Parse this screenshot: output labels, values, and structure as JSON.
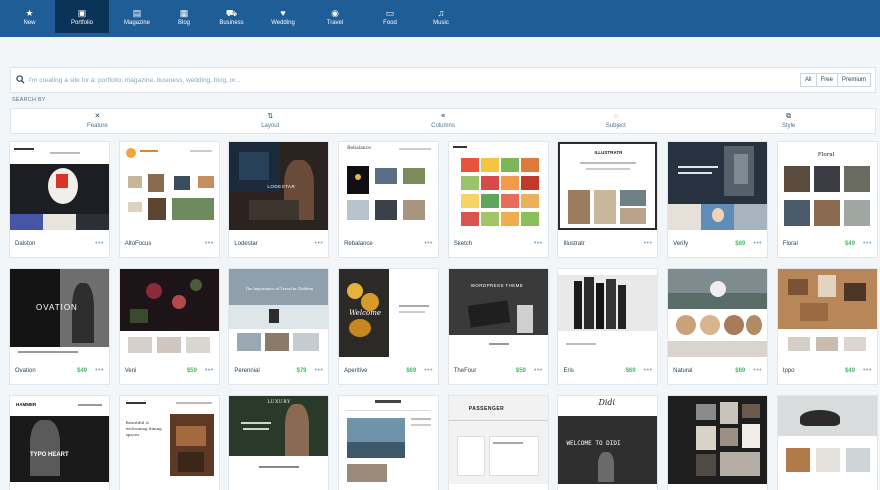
{
  "nav": {
    "items": [
      {
        "label": "New",
        "icon": "★"
      },
      {
        "label": "Portfolio",
        "icon": "▣"
      },
      {
        "label": "Magazine",
        "icon": "▤"
      },
      {
        "label": "Blog",
        "icon": "▦"
      },
      {
        "label": "Business",
        "icon": "⛟"
      },
      {
        "label": "Wedding",
        "icon": "♥"
      },
      {
        "label": "Travel",
        "icon": "◉"
      },
      {
        "label": "Food",
        "icon": "▭"
      },
      {
        "label": "Music",
        "icon": "♫"
      }
    ],
    "active": "Portfolio"
  },
  "search": {
    "placeholder": "I'm creating a site for a: portfolio, magazine, business, wedding, blog, or...",
    "icon": "search-icon",
    "filters": [
      "All",
      "Free",
      "Premium"
    ]
  },
  "search_by": "SEARCH BY",
  "facets": [
    {
      "label": "Feature",
      "icon": "✕"
    },
    {
      "label": "Layout",
      "icon": "⇅"
    },
    {
      "label": "Columns",
      "icon": "≡"
    },
    {
      "label": "Subject",
      "icon": "◌"
    },
    {
      "label": "Style",
      "icon": "⧉"
    }
  ],
  "themes": [
    {
      "name": "Dalston",
      "price": ""
    },
    {
      "name": "AltoFocus",
      "price": ""
    },
    {
      "name": "Lodestar",
      "price": ""
    },
    {
      "name": "Rebalance",
      "price": ""
    },
    {
      "name": "Sketch",
      "price": ""
    },
    {
      "name": "Illustratr",
      "price": ""
    },
    {
      "name": "Verify",
      "price": "$69"
    },
    {
      "name": "Floral",
      "price": "$49"
    },
    {
      "name": "Ovation",
      "price": "$49"
    },
    {
      "name": "Veni",
      "price": "$59"
    },
    {
      "name": "Perennial",
      "price": "$79"
    },
    {
      "name": "Aperitive",
      "price": "$69"
    },
    {
      "name": "TheFour",
      "price": "$59"
    },
    {
      "name": "Eris",
      "price": "$69"
    },
    {
      "name": "Natural",
      "price": "$69"
    },
    {
      "name": "Ippo",
      "price": "$49"
    },
    {
      "name": "",
      "price": ""
    },
    {
      "name": "",
      "price": ""
    },
    {
      "name": "",
      "price": ""
    },
    {
      "name": "",
      "price": ""
    },
    {
      "name": "",
      "price": ""
    },
    {
      "name": "",
      "price": ""
    },
    {
      "name": "",
      "price": ""
    },
    {
      "name": "",
      "price": ""
    }
  ],
  "thumb_text": {
    "lodestar": "LODESTAR",
    "rebalance": "Rebalance",
    "illustratr": "ILLUSTRATR",
    "floral": "Floral",
    "ovation": "OVATION",
    "perennial": "The Importance of Travel in Children",
    "aperitive": "Welcome",
    "thefour": "WORDPRESS THEME",
    "hammer": "HAMMER",
    "typo": "TYPO HEART",
    "patents": "Beautiful & welcoming dining spaces",
    "luxury": "LUXURY",
    "passenger": "PASSENGER",
    "didi_script": "Didi",
    "didi": "WELCOME TO DIDI"
  },
  "more_label": "•••"
}
